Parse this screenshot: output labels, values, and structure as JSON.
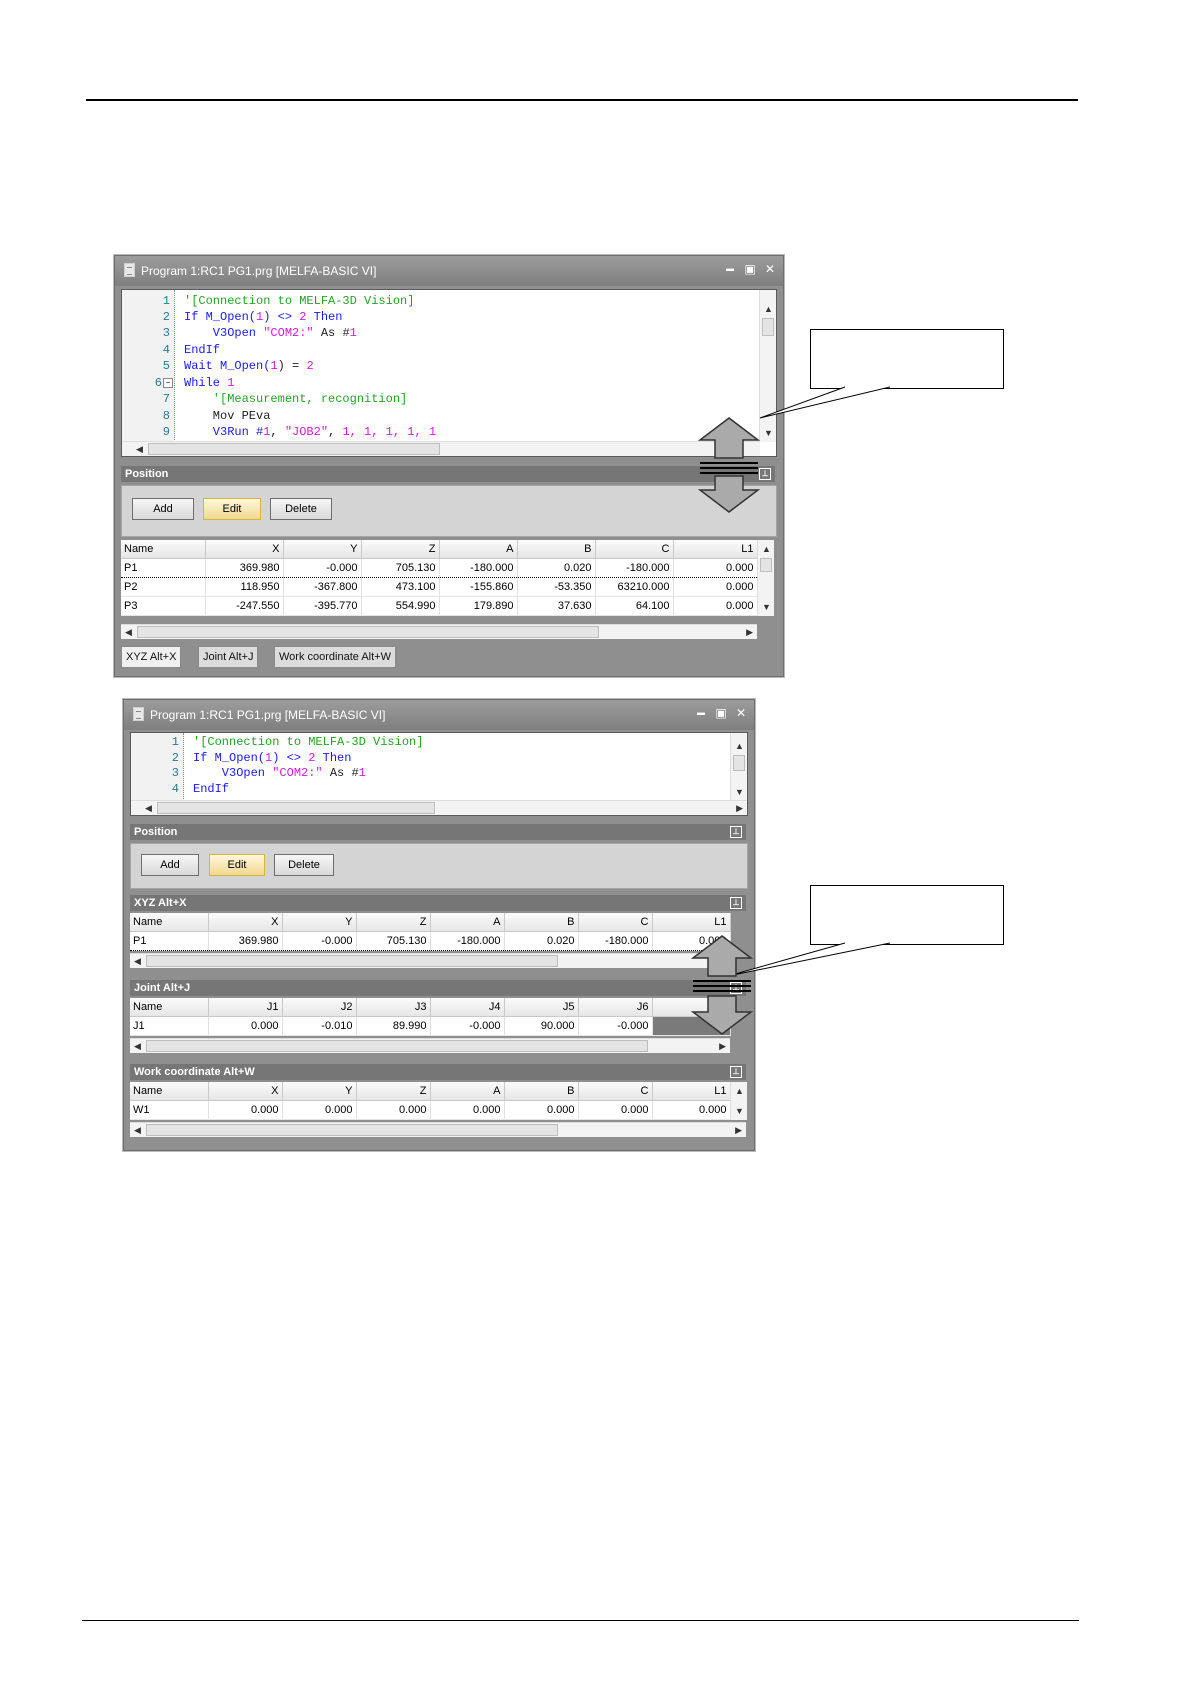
{
  "window1": {
    "title": "Program 1:RC1 PG1.prg   [MELFA-BASIC VI]",
    "controls": {
      "minimize": "▬",
      "restore": "▣",
      "close": "✕"
    },
    "code": {
      "line_numbers": [
        "1",
        "2",
        "3",
        "4",
        "5",
        "6",
        "7",
        "8",
        "9"
      ],
      "l1": "'[Connection to MELFA-3D Vision]",
      "l2a": "If M_Open(",
      "l2b": "1",
      "l2c": ") <> ",
      "l2d": "2",
      "l2e": " Then",
      "l3a": "    V3Open ",
      "l3b": "\"COM2:\"",
      "l3c": " As #",
      "l3d": "1",
      "l4": "EndIf",
      "l5a": "Wait M_Open(",
      "l5b": "1",
      "l5c": ") = ",
      "l5d": "2",
      "l6a": "While ",
      "l6b": "1",
      "l7": "    '[Measurement, recognition]",
      "l8": "    Mov PEva",
      "l9a": "    V3Run #",
      "l9b": "1",
      "l9c": ", ",
      "l9d": "\"JOB2\"",
      "l9e": ", ",
      "l9f": "1, 1, 1, 1, 1"
    },
    "panel_title": "Position",
    "buttons": {
      "add": "Add",
      "edit": "Edit",
      "delete": "Delete"
    },
    "grid": {
      "headers": [
        "Name",
        "X",
        "Y",
        "Z",
        "A",
        "B",
        "C",
        "L1"
      ],
      "rows": [
        [
          "P1",
          "369.980",
          "-0.000",
          "705.130",
          "-180.000",
          "0.020",
          "-180.000",
          "0.000"
        ],
        [
          "P2",
          "118.950",
          "-367.800",
          "473.100",
          "-155.860",
          "-53.350",
          "63210.000",
          "0.000"
        ],
        [
          "P3",
          "-247.550",
          "-395.770",
          "554.990",
          "179.890",
          "37.630",
          "64.100",
          "0.000"
        ]
      ]
    },
    "tabs": [
      "XYZ   Alt+X",
      "Joint   Alt+J",
      "Work coordinate    Alt+W"
    ]
  },
  "window2": {
    "title": "Program 1:RC1 PG1.prg   [MELFA-BASIC VI]",
    "code": {
      "line_numbers": [
        "1",
        "2",
        "3",
        "4"
      ],
      "l1": "'[Connection to MELFA-3D Vision]",
      "l2a": "If M_Open(",
      "l2b": "1",
      "l2c": ") <> ",
      "l2d": "2",
      "l2e": " Then",
      "l3a": "    V3Open ",
      "l3b": "\"COM2:\"",
      "l3c": " As #",
      "l3d": "1",
      "l4": "EndIf"
    },
    "panel_title": "Position",
    "buttons": {
      "add": "Add",
      "edit": "Edit",
      "delete": "Delete"
    },
    "xyz": {
      "title": "XYZ   Alt+X",
      "headers": [
        "Name",
        "X",
        "Y",
        "Z",
        "A",
        "B",
        "C",
        "L1"
      ],
      "rows": [
        [
          "P1",
          "369.980",
          "-0.000",
          "705.130",
          "-180.000",
          "0.020",
          "-180.000",
          "0.000"
        ]
      ]
    },
    "joint": {
      "title": "Joint   Alt+J",
      "headers": [
        "Name",
        "J1",
        "J2",
        "J3",
        "J4",
        "J5",
        "J6",
        ""
      ],
      "rows": [
        [
          "J1",
          "0.000",
          "-0.010",
          "89.990",
          "-0.000",
          "90.000",
          "-0.000",
          ""
        ]
      ]
    },
    "work": {
      "title": "Work coordinate   Alt+W",
      "headers": [
        "Name",
        "X",
        "Y",
        "Z",
        "A",
        "B",
        "C",
        "L1"
      ],
      "rows": [
        [
          "W1",
          "0.000",
          "0.000",
          "0.000",
          "0.000",
          "0.000",
          "0.000",
          "0.000"
        ]
      ]
    }
  }
}
